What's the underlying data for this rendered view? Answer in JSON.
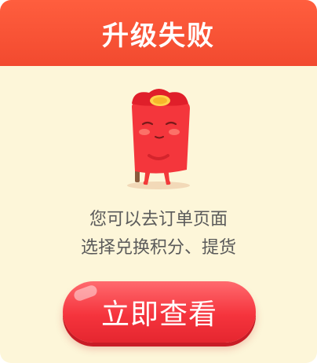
{
  "dialog": {
    "title": "升级失败",
    "message_line1": "您可以去订单页面",
    "message_line2": "选择兑换积分、提货",
    "cta_label": "立即查看"
  },
  "icons": {
    "mascot": "red-envelope-mascot-icon"
  },
  "colors": {
    "header_bg": "#f24a2f",
    "body_bg": "#fdf6d9",
    "button_bg": "#f5343d",
    "text": "#5a5a5a"
  }
}
